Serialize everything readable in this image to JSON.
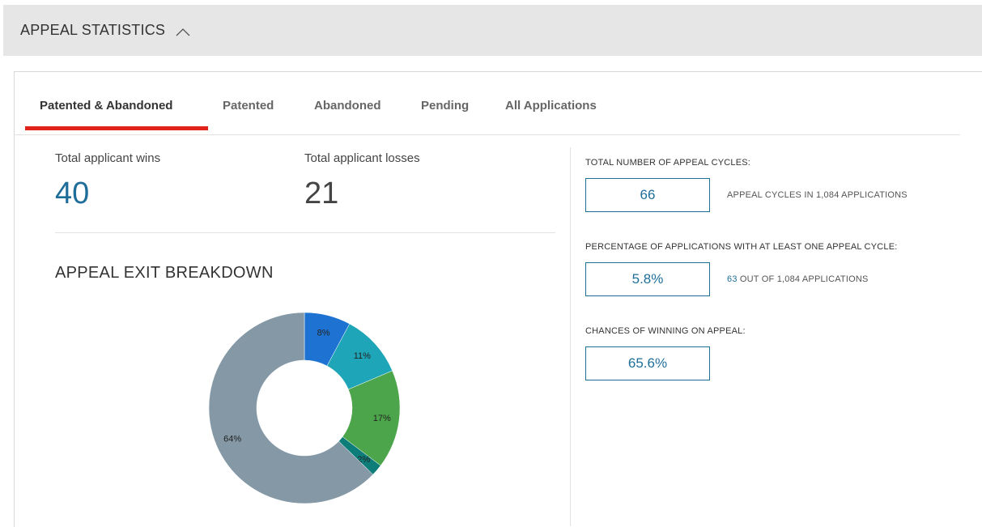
{
  "header": {
    "title": "APPEAL STATISTICS",
    "toggle_icon": "chevron-up-icon"
  },
  "tabs": [
    {
      "label": "Patented & Abandoned",
      "active": true
    },
    {
      "label": "Patented",
      "active": false
    },
    {
      "label": "Abandoned",
      "active": false
    },
    {
      "label": "Pending",
      "active": false
    },
    {
      "label": "All Applications",
      "active": false
    }
  ],
  "stats": {
    "wins_label": "Total applicant wins",
    "wins_value": "40",
    "losses_label": "Total applicant losses",
    "losses_value": "21"
  },
  "breakdown": {
    "title": "APPEAL EXIT BREAKDOWN"
  },
  "chart_data": {
    "type": "pie",
    "donut": true,
    "title": "APPEAL EXIT BREAKDOWN",
    "slices": [
      {
        "label": "8%",
        "value": 8,
        "color": "#1e73d2"
      },
      {
        "label": "11%",
        "value": 11,
        "color": "#1ea6b8"
      },
      {
        "label": "17%",
        "value": 17,
        "color": "#4ca54a"
      },
      {
        "label": "2%",
        "value": 2,
        "color": "#0d7d7a"
      },
      {
        "label": "64%",
        "value": 64,
        "color": "#8499a5"
      }
    ]
  },
  "right_panel": {
    "cycles_label": "TOTAL NUMBER OF APPEAL CYCLES:",
    "cycles_value": "66",
    "cycles_note": "APPEAL CYCLES IN 1,084 APPLICATIONS",
    "pct_label": "PERCENTAGE OF APPLICATIONS WITH AT LEAST ONE APPEAL CYCLE:",
    "pct_value": "5.8%",
    "pct_note_link": "63",
    "pct_note_rest": " OUT OF 1,084 APPLICATIONS",
    "chances_label": "CHANCES OF WINNING ON APPEAL:",
    "chances_value": "65.6%"
  },
  "colors": {
    "accent_red": "#e2231a",
    "accent_blue": "#1f6e9a",
    "header_bg": "#e6e6e6"
  }
}
